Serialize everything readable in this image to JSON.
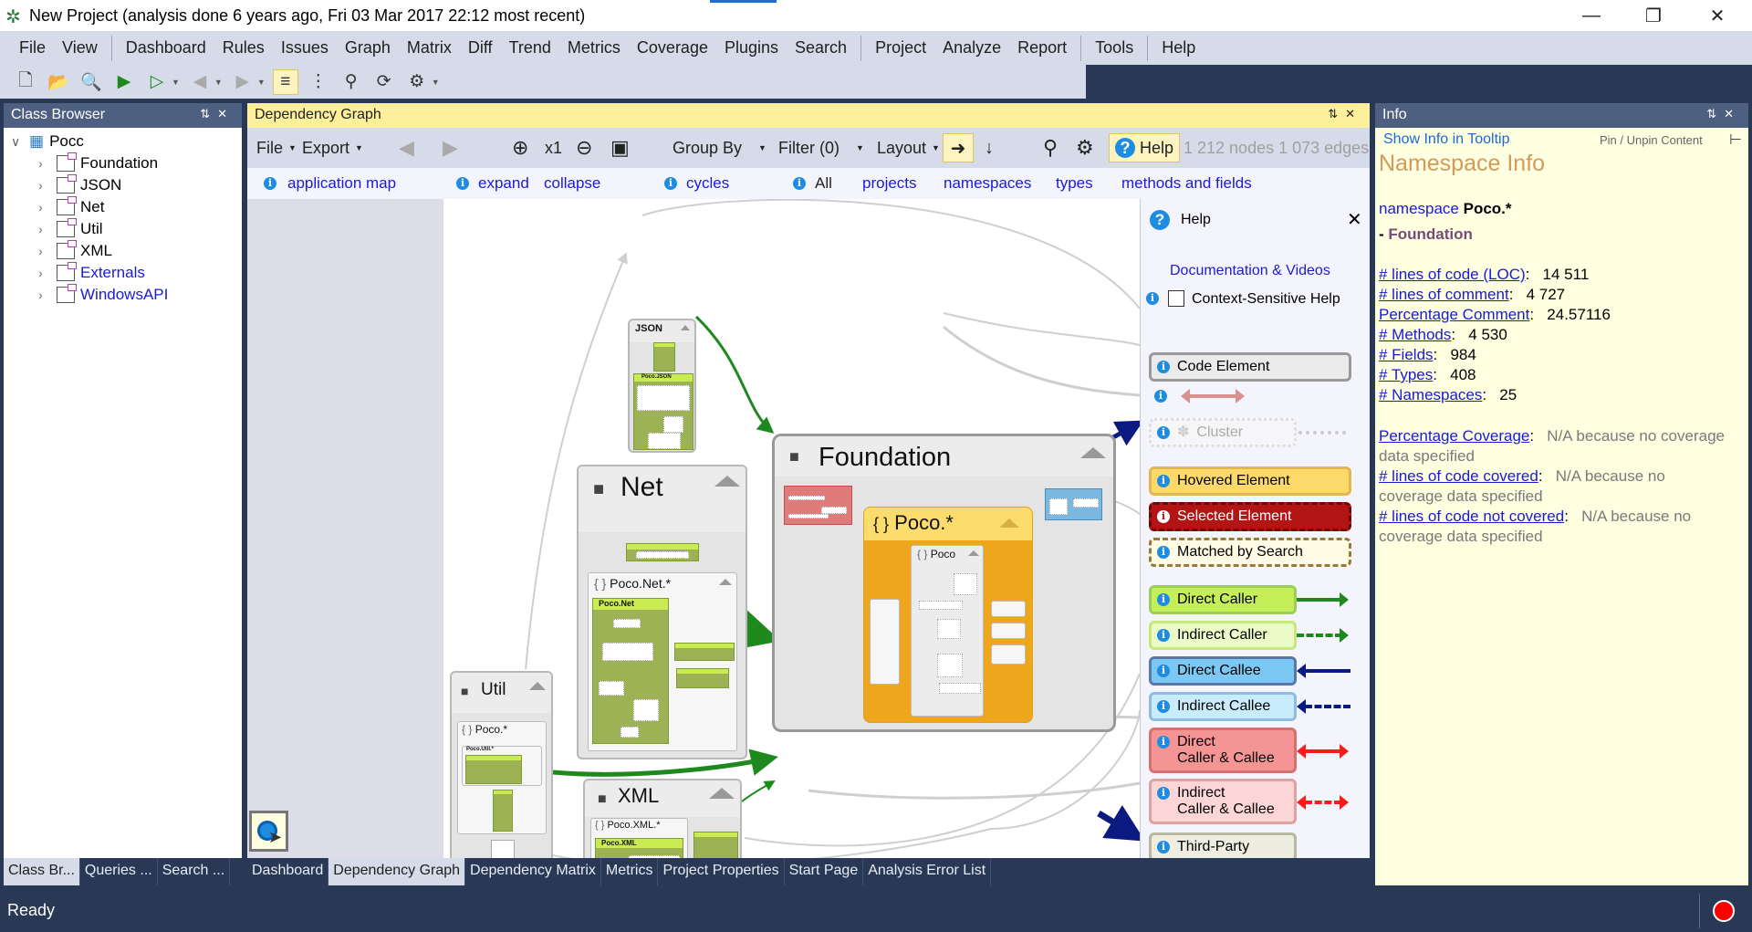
{
  "window": {
    "title": "New Project  (analysis done 6 years ago, Fri 03 Mar 2017  22:12 most recent)",
    "controls": [
      "minimize-icon",
      "restore-icon",
      "close-icon"
    ]
  },
  "menu": [
    "File",
    "View",
    "Dashboard",
    "Rules",
    "Issues",
    "Graph",
    "Matrix",
    "Diff",
    "Trend",
    "Metrics",
    "Coverage",
    "Plugins",
    "Search",
    "Project",
    "Analyze",
    "Report",
    "Tools",
    "Help"
  ],
  "toolbar_icons": [
    "new-project-icon",
    "open-project-icon",
    "compare-icon",
    "run-analysis-icon",
    "analyze-options-icon",
    "back-icon",
    "forward-icon",
    "tree-view-icon",
    "list-view-icon",
    "search-icon",
    "refresh-icon",
    "settings-icon"
  ],
  "class_browser": {
    "title": "Class Browser",
    "root": "Pocc",
    "items": [
      {
        "label": "Foundation",
        "external": false
      },
      {
        "label": "JSON",
        "external": false
      },
      {
        "label": "Net",
        "external": false
      },
      {
        "label": "Util",
        "external": false
      },
      {
        "label": "XML",
        "external": false
      },
      {
        "label": "Externals",
        "external": true
      },
      {
        "label": "WindowsAPI",
        "external": true
      }
    ]
  },
  "dependency_graph": {
    "title": "Dependency Graph",
    "toolbar": {
      "file": "File",
      "export": "Export",
      "zoom": "x1",
      "group_by": "Group By",
      "filter": "Filter (0)",
      "layout": "Layout",
      "help": "Help",
      "stats": "1 212 nodes 1 073 edges"
    },
    "links": {
      "application_map": "application map",
      "expand": "expand",
      "collapse": "collapse",
      "cycles": "cycles",
      "all": "All",
      "projects": "projects",
      "namespaces": "namespaces",
      "types": "types",
      "methods_and_fields": "methods and fields"
    },
    "nodes": {
      "json": "JSON",
      "poco_json": "Poco.JSON",
      "net": "Net",
      "poco_net_ns": "Poco.Net.*",
      "poco_net": "Poco.Net",
      "foundation": "Foundation",
      "poco_star": "Poco.*",
      "poco": "Poco",
      "util": "Util",
      "util_poco_star": "Poco.*",
      "poco_util": "Poco.Util.*",
      "xml": "XML",
      "poco_xml_ns": "Poco.XML.*",
      "poco_xml": "Poco.XML"
    },
    "help_panel": {
      "title": "Help",
      "docs_link": "Documentation & Videos",
      "context_help": "Context-Sensitive Help",
      "context_help_checked": false,
      "legend": {
        "code_element": "Code Element",
        "cluster": "Cluster",
        "hovered": "Hovered Element",
        "selected": "Selected Element",
        "matched": "Matched by Search",
        "direct_caller": "Direct Caller",
        "indirect_caller": "Indirect Caller",
        "direct_callee": "Direct Callee",
        "indirect_callee": "Indirect Callee",
        "direct_both_1": "Direct",
        "direct_both_2": "Caller & Callee",
        "indirect_both_1": "Indirect",
        "indirect_both_2": "Caller & Callee",
        "third_party": "Third-Party"
      }
    }
  },
  "info": {
    "title": "Info",
    "show_in_tooltip": "Show Info in Tooltip",
    "pin": "Pin / Unpin Content",
    "heading": "Namespace Info",
    "namespace_kw": "namespace",
    "namespace_name": "Poco.*",
    "assembly_prefix": "- ",
    "assembly": "Foundation",
    "metrics": [
      {
        "label": "# lines of code (LOC)",
        "value": "14 511"
      },
      {
        "label": "# lines of comment",
        "value": "4 727"
      },
      {
        "label": "Percentage Comment",
        "value": "24.57116"
      },
      {
        "label": "# Methods",
        "value": "4 530"
      },
      {
        "label": "# Fields",
        "value": "984"
      },
      {
        "label": "# Types",
        "value": "408"
      },
      {
        "label": "# Namespaces",
        "value": "25"
      }
    ],
    "coverage": [
      {
        "label": "Percentage Coverage",
        "value1": "N/A because no coverage",
        "value2": "data specified"
      },
      {
        "label": "# lines of code covered",
        "value1": "N/A because no",
        "value2": "coverage data specified"
      },
      {
        "label": "# lines of code not covered",
        "value1": "N/A because no",
        "value2": "coverage data specified"
      }
    ]
  },
  "bottom_tabs_left": [
    "Class Br...",
    "Queries ...",
    "Search ..."
  ],
  "bottom_tabs_main": [
    "Dashboard",
    "Dependency Graph",
    "Dependency Matrix",
    "Metrics",
    "Project Properties",
    "Start Page",
    "Analysis Error List"
  ],
  "bottom_tabs_main_selected": "Dependency Graph",
  "status": {
    "text": "Ready"
  },
  "colors": {
    "chrome": "#293955",
    "menu_bg": "#d6dbe9",
    "doc_header": "#fdef9b",
    "info_bg": "#fefee0",
    "link": "#1a1ad8",
    "caller": "#1e8a1e",
    "callee": "#0a1a80",
    "both": "#ff1a1a",
    "namespace_fill": "#eea71c"
  }
}
